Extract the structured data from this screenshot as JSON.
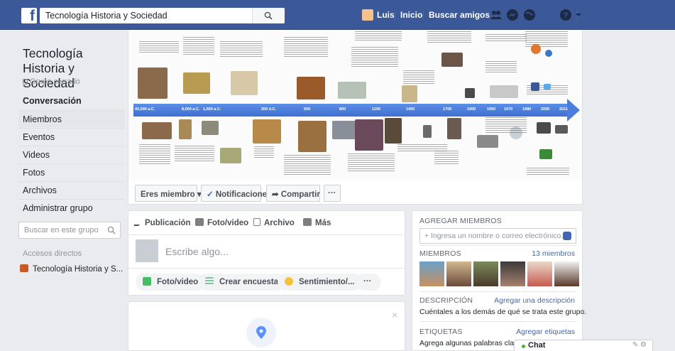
{
  "topbar": {
    "search_value": "Tecnología Historia y Sociedad",
    "user_name": "Luis",
    "home_label": "Inicio",
    "find_friends_label": "Buscar amigos",
    "brand_color": "#3b5998"
  },
  "group": {
    "title": "Tecnología Historia y Sociedad",
    "privacy": "Grupo cerrado"
  },
  "left_nav": [
    {
      "label": "Conversación"
    },
    {
      "label": "Miembros"
    },
    {
      "label": "Eventos"
    },
    {
      "label": "Videos"
    },
    {
      "label": "Fotos"
    },
    {
      "label": "Archivos"
    },
    {
      "label": "Administrar grupo"
    }
  ],
  "left_search": {
    "placeholder": "Buscar en este grupo"
  },
  "shortcuts": {
    "title": "Accesos directos",
    "item": "Tecnología Historia y S..."
  },
  "timeline": {
    "ticks": [
      "40,000 a.C.",
      "8,000 a.C.",
      "1,000 a.C.",
      "200 d.C.",
      "500",
      "800",
      "1100",
      "1400",
      "1700",
      "1900",
      "1950",
      "1970",
      "1980",
      "2000",
      "2011"
    ]
  },
  "actions": {
    "member_label": "Eres miembro",
    "notifications_label": "Notificaciones",
    "share_label": "Compartir",
    "more_label": "···"
  },
  "composer": {
    "tabs": [
      "Publicación",
      "Foto/video",
      "Archivo",
      "Más"
    ],
    "placeholder": "Escribe algo...",
    "chips": [
      "Foto/video",
      "Crear encuesta",
      "Sentimiento/...",
      "···"
    ]
  },
  "right_panel": {
    "add_members_title": "AGREGAR MIEMBROS",
    "add_members_placeholder": "+ Ingresa un nombre o correo electrónico...",
    "members_title": "MIEMBROS",
    "members_count": "13 miembros",
    "description_title": "DESCRIPCIÓN",
    "description_link": "Agregar una descripción",
    "description_text": "Cuéntales a los demás de qué se trata este grupo.",
    "tags_title": "ETIQUETAS",
    "tags_link": "Agregar etiquetas",
    "tags_text": "Agrega algunas palabras clave"
  },
  "chat": {
    "label": "Chat"
  }
}
